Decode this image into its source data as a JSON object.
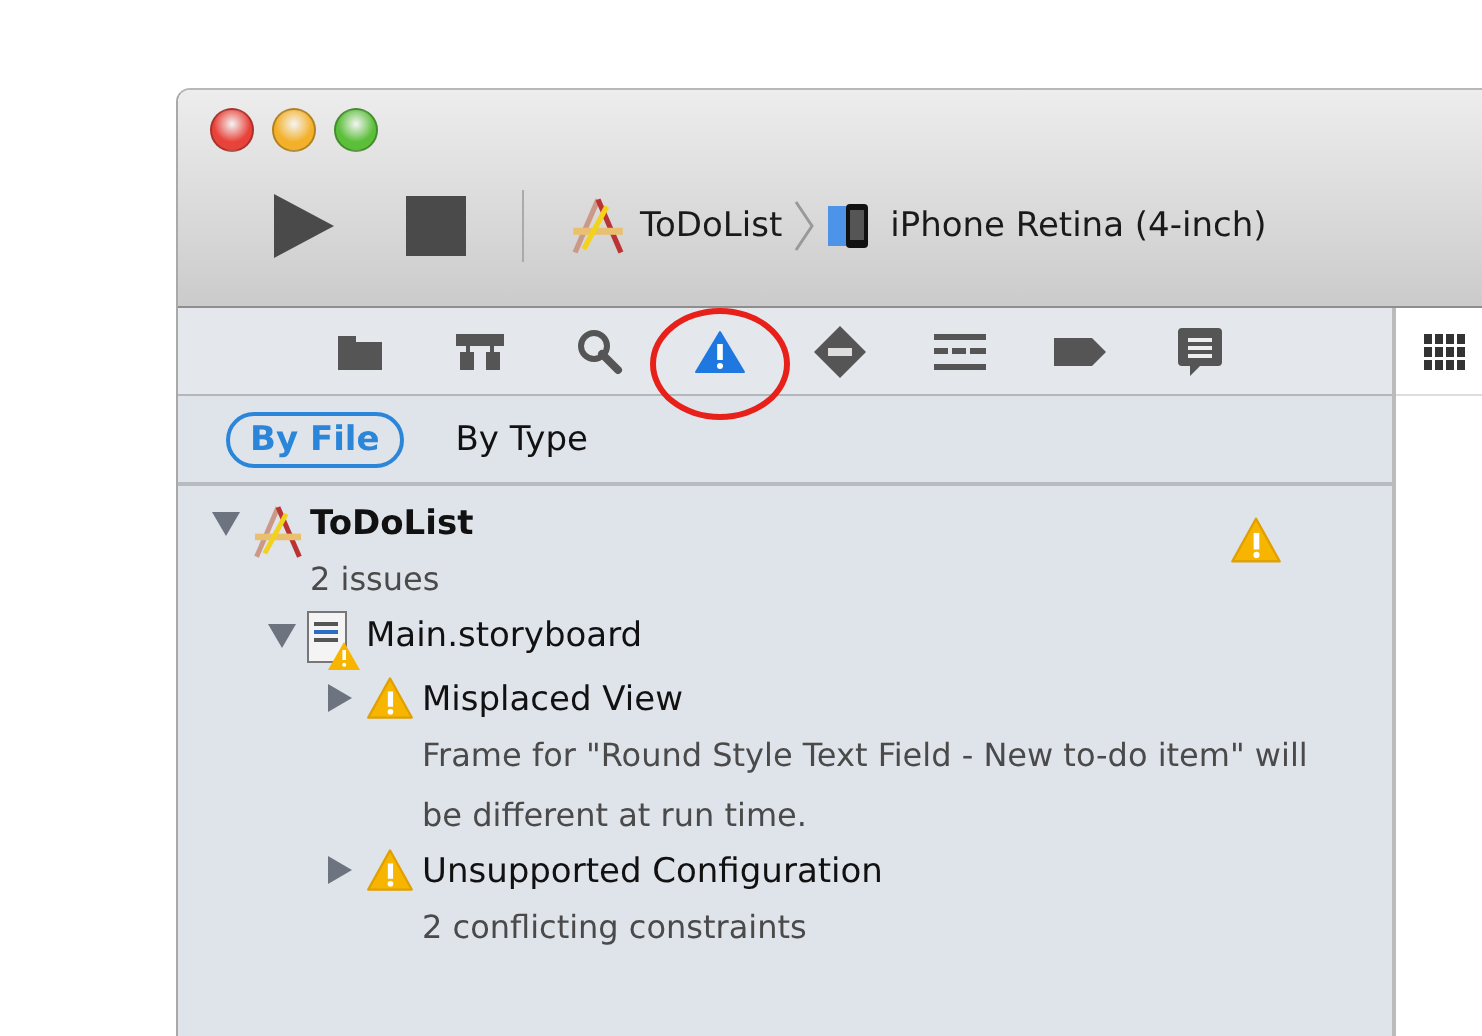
{
  "toolbar": {
    "scheme": "ToDoList",
    "destination": "iPhone Retina (4-inch)"
  },
  "navigator_tabs": [
    {
      "kind": "folder",
      "selected": false
    },
    {
      "kind": "hierarchy",
      "selected": false
    },
    {
      "kind": "search",
      "selected": false
    },
    {
      "kind": "issue",
      "selected": true
    },
    {
      "kind": "breakpoint-diamond",
      "selected": false
    },
    {
      "kind": "list",
      "selected": false
    },
    {
      "kind": "tag",
      "selected": false
    },
    {
      "kind": "log",
      "selected": false
    }
  ],
  "scope_bar": [
    {
      "label": "By File",
      "selected": true
    },
    {
      "label": "By Type",
      "selected": false
    }
  ],
  "issues": [
    {
      "kind": "project",
      "name": "ToDoList",
      "subtitle": "2 issues",
      "expanded": true,
      "warning": true,
      "children": [
        {
          "kind": "storyboard",
          "name": "Main.storyboard",
          "expanded": true,
          "warning": true,
          "children": [
            {
              "kind": "issue",
              "name": "Misplaced View",
              "subtitle": "Frame for \"Round Style Text Field - New to-do item\" will be different at run time.",
              "expanded": false
            },
            {
              "kind": "issue",
              "name": "Unsupported Configuration",
              "subtitle": "2 conflicting constraints",
              "expanded": false
            }
          ]
        }
      ]
    }
  ]
}
